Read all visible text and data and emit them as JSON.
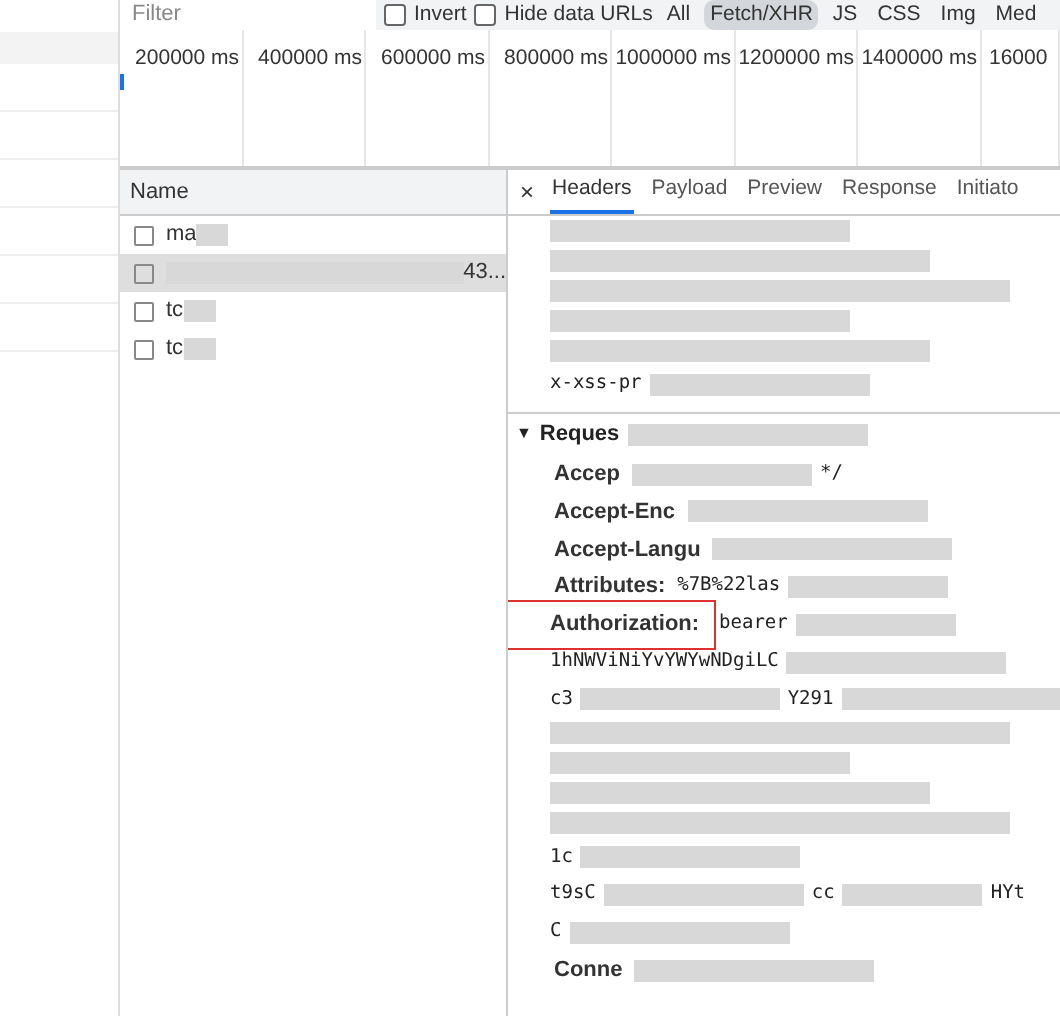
{
  "filter_bar": {
    "placeholder": "Filter",
    "checkboxes": [
      {
        "label": "Invert",
        "checked": false
      },
      {
        "label": "Hide data URLs",
        "checked": false
      }
    ],
    "types": [
      {
        "label": "All",
        "selected": false
      },
      {
        "label": "Fetch/XHR",
        "selected": true
      },
      {
        "label": "JS",
        "selected": false
      },
      {
        "label": "CSS",
        "selected": false
      },
      {
        "label": "Img",
        "selected": false
      },
      {
        "label": "Med",
        "selected": false
      }
    ]
  },
  "timeline": {
    "ticks": [
      "200000 ms",
      "400000 ms",
      "600000 ms",
      "800000 ms",
      "1000000 ms",
      "1200000 ms",
      "1400000 ms",
      "16000"
    ]
  },
  "requests": {
    "column": "Name",
    "rows": [
      {
        "text": "ma",
        "kind": "tail",
        "selected": false
      },
      {
        "text": "43...",
        "kind": "head",
        "selected": true
      },
      {
        "text": "tc",
        "kind": "tail",
        "selected": false
      },
      {
        "text": "tc",
        "kind": "tail",
        "selected": false
      }
    ]
  },
  "details": {
    "close": "×",
    "tabs": [
      {
        "label": "Headers",
        "selected": true
      },
      {
        "label": "Payload",
        "selected": false
      },
      {
        "label": "Preview",
        "selected": false
      },
      {
        "label": "Response",
        "selected": false
      },
      {
        "label": "Initiato",
        "selected": false
      }
    ],
    "lines": [
      {
        "kind": "redacted"
      },
      {
        "kind": "redacted"
      },
      {
        "kind": "redacted"
      },
      {
        "kind": "redacted"
      },
      {
        "kind": "redacted"
      },
      {
        "kind": "plain",
        "parts": [
          "x-xss-pr"
        ]
      },
      {
        "kind": "section",
        "toggle": "▼",
        "text": "Reques"
      },
      {
        "kind": "header",
        "name": "Accep",
        "parts": [
          "*/"
        ],
        "highlighted": false
      },
      {
        "kind": "header",
        "name": "Accept-Enc",
        "highlighted": false
      },
      {
        "kind": "header",
        "name": "Accept-Langu",
        "highlighted": false
      },
      {
        "kind": "header",
        "name": "Attributes:",
        "parts": [
          "%7B%22las"
        ],
        "highlighted": false
      },
      {
        "kind": "header",
        "name": "Authorization:",
        "parts": [
          "bearer"
        ],
        "highlighted": true
      },
      {
        "kind": "plain",
        "parts": [
          "1hNWViNiYvYWYwNDgiLC"
        ]
      },
      {
        "kind": "plain",
        "parts": [
          "c3",
          "Y291"
        ]
      },
      {
        "kind": "redacted"
      },
      {
        "kind": "redacted"
      },
      {
        "kind": "redacted"
      },
      {
        "kind": "redacted"
      },
      {
        "kind": "plain",
        "parts": [
          "1c"
        ]
      },
      {
        "kind": "plain",
        "parts": [
          "t9sC",
          "cc",
          "HYt"
        ]
      },
      {
        "kind": "plain",
        "parts": [
          "C"
        ]
      },
      {
        "kind": "header",
        "name": "Conne",
        "highlighted": false
      }
    ]
  }
}
